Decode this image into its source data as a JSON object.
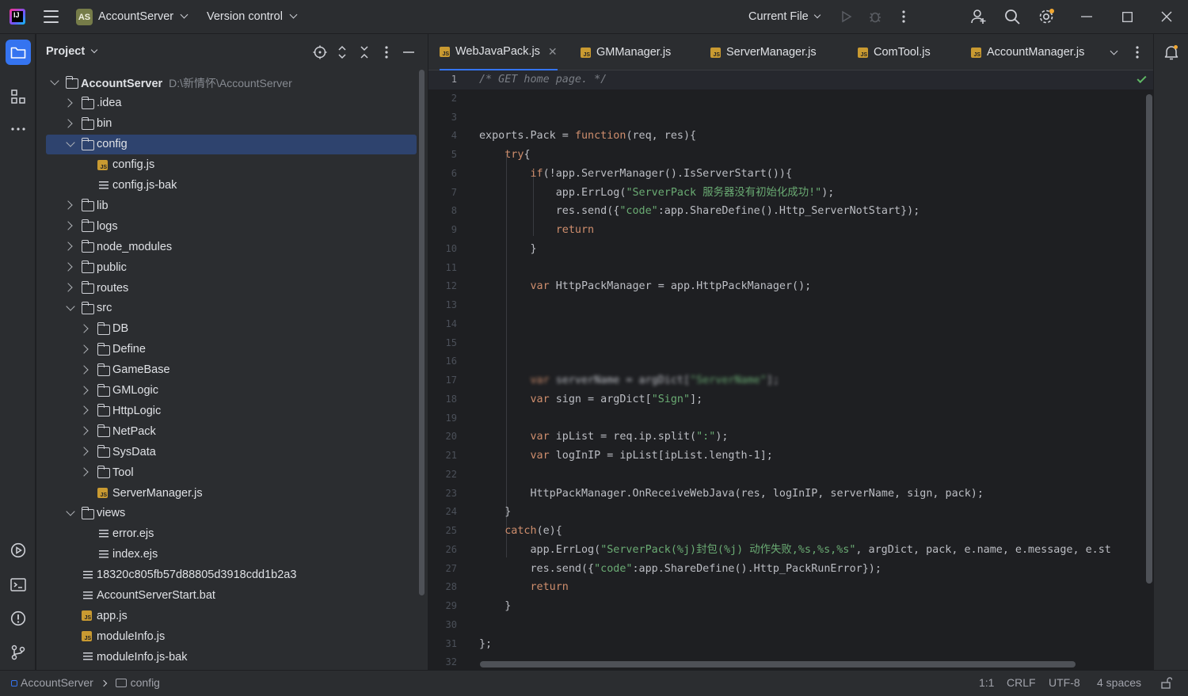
{
  "titlebar": {
    "project_badge": "AS",
    "project_name": "AccountServer",
    "version_control": "Version control",
    "run_config": "Current File",
    "icons": [
      "ide-logo-icon",
      "main-menu-icon",
      "run-icon",
      "debug-icon",
      "more-icon",
      "add-user-icon",
      "search-icon",
      "settings-icon",
      "minimize-icon",
      "maximize-icon",
      "close-icon"
    ]
  },
  "project_panel": {
    "title": "Project",
    "tree": [
      {
        "label": "AccountServer",
        "hint": "D:\\新情怀\\AccountServer",
        "type": "root",
        "depth": 0,
        "expanded": true
      },
      {
        "label": ".idea",
        "type": "folder",
        "depth": 1,
        "expanded": false
      },
      {
        "label": "bin",
        "type": "folder",
        "depth": 1,
        "expanded": false
      },
      {
        "label": "config",
        "type": "folder",
        "depth": 1,
        "expanded": true,
        "selected": true
      },
      {
        "label": "config.js",
        "type": "js",
        "depth": 2
      },
      {
        "label": "config.js-bak",
        "type": "text",
        "depth": 2
      },
      {
        "label": "lib",
        "type": "folder",
        "depth": 1,
        "expanded": false
      },
      {
        "label": "logs",
        "type": "folder",
        "depth": 1,
        "expanded": false
      },
      {
        "label": "node_modules",
        "type": "folder",
        "depth": 1,
        "expanded": false
      },
      {
        "label": "public",
        "type": "folder",
        "depth": 1,
        "expanded": false
      },
      {
        "label": "routes",
        "type": "folder",
        "depth": 1,
        "expanded": false
      },
      {
        "label": "src",
        "type": "folder",
        "depth": 1,
        "expanded": true
      },
      {
        "label": "DB",
        "type": "folder",
        "depth": 2,
        "expanded": false
      },
      {
        "label": "Define",
        "type": "folder",
        "depth": 2,
        "expanded": false
      },
      {
        "label": "GameBase",
        "type": "folder",
        "depth": 2,
        "expanded": false
      },
      {
        "label": "GMLogic",
        "type": "folder",
        "depth": 2,
        "expanded": false
      },
      {
        "label": "HttpLogic",
        "type": "folder",
        "depth": 2,
        "expanded": false
      },
      {
        "label": "NetPack",
        "type": "folder",
        "depth": 2,
        "expanded": false
      },
      {
        "label": "SysData",
        "type": "folder",
        "depth": 2,
        "expanded": false
      },
      {
        "label": "Tool",
        "type": "folder",
        "depth": 2,
        "expanded": false
      },
      {
        "label": "ServerManager.js",
        "type": "js",
        "depth": 2
      },
      {
        "label": "views",
        "type": "folder",
        "depth": 1,
        "expanded": true
      },
      {
        "label": "error.ejs",
        "type": "text",
        "depth": 2
      },
      {
        "label": "index.ejs",
        "type": "text",
        "depth": 2
      },
      {
        "label": "18320c805fb57d88805d3918cdd1b2a3",
        "type": "text",
        "depth": 1
      },
      {
        "label": "AccountServerStart.bat",
        "type": "text",
        "depth": 1
      },
      {
        "label": "app.js",
        "type": "js",
        "depth": 1
      },
      {
        "label": "moduleInfo.js",
        "type": "js",
        "depth": 1
      },
      {
        "label": "moduleInfo.js-bak",
        "type": "text",
        "depth": 1
      }
    ]
  },
  "editor": {
    "tabs": [
      {
        "label": "WebJavaPack.js",
        "active": true
      },
      {
        "label": "GMManager.js"
      },
      {
        "label": "ServerManager.js"
      },
      {
        "label": "ComTool.js"
      },
      {
        "label": "AccountManager.js"
      }
    ],
    "lines": [
      "/* GET home page. */",
      "",
      "",
      "exports.Pack = function(req, res){",
      "    try{",
      "        if(!app.ServerManager().IsServerStart()){",
      "            app.ErrLog(\"ServerPack 服务器没有初始化成功!\");",
      "            res.send({\"code\":app.ShareDefine().Http_ServerNotStart});",
      "            return",
      "        }",
      "",
      "        var HttpPackManager = app.HttpPackManager();",
      "",
      "",
      "",
      "",
      "        var serverName = argDict[\"ServerName\"];",
      "        var sign = argDict[\"Sign\"];",
      "",
      "        var ipList = req.ip.split(\":\");",
      "        var logInIP = ipList[ipList.length-1];",
      "",
      "        HttpPackManager.OnReceiveWebJava(res, logInIP, serverName, sign, pack);",
      "    }",
      "    catch(e){",
      "        app.ErrLog(\"ServerPack(%j)封包(%j) 动作失败,%s,%s,%s\", argDict, pack, e.name, e.message, e.st",
      "        res.send({\"code\":app.ShareDefine().Http_PackRunError});",
      "        return",
      "    }",
      "",
      "};",
      ""
    ]
  },
  "status": {
    "breadcrumb_root": "AccountServer",
    "breadcrumb_folder": "config",
    "position": "1:1",
    "line_sep": "CRLF",
    "encoding": "UTF-8",
    "indent": "4 spaces"
  },
  "colors": {
    "accent": "#3574f0",
    "selection": "#2e436e",
    "keyword": "#cf8e6d",
    "string": "#6aab73",
    "function": "#56a8f5"
  }
}
